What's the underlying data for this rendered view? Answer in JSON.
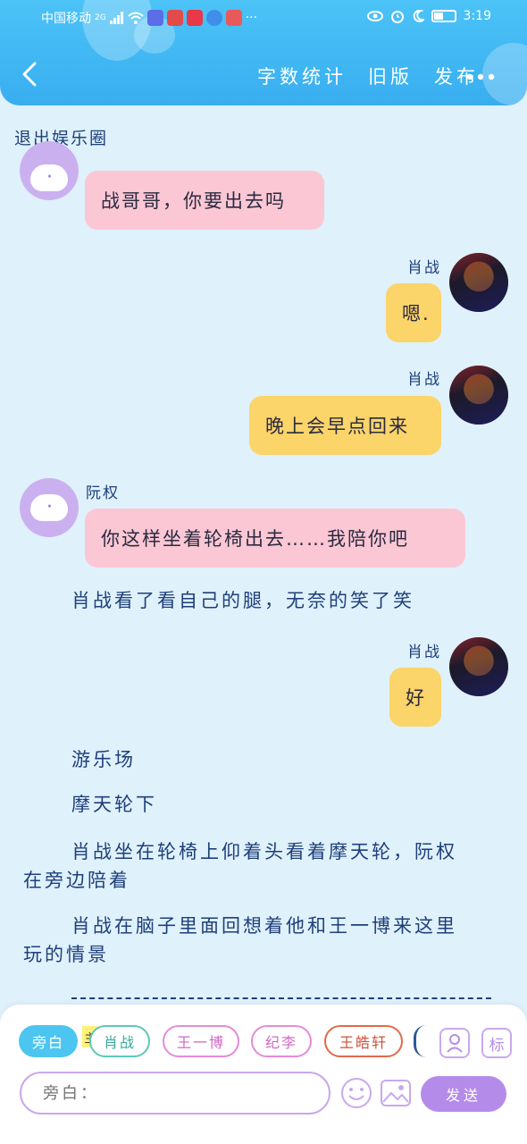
{
  "status_bar": {
    "carrier": "中国移动",
    "network": "2G",
    "more": "···",
    "time": "3:19"
  },
  "header": {
    "back_icon": "chevron-left-icon",
    "word_count": "字数统计",
    "old_version": "旧版",
    "publish": "发布",
    "more_icon": "more-horizontal-icon"
  },
  "story": {
    "title": "退出娱乐圈"
  },
  "messages": [
    {
      "speaker": "",
      "side": "left",
      "text": "战哥哥，你要出去吗",
      "color": "#fbc7d4"
    },
    {
      "speaker": "肖战",
      "side": "right",
      "text": "嗯.",
      "color": "#fbd46a"
    },
    {
      "speaker": "肖战",
      "side": "right",
      "text": "晚上会早点回来",
      "color": "#fbd46a"
    },
    {
      "speaker": "阮权",
      "side": "left",
      "text": "你这样坐着轮椅出去……我陪你吧",
      "color": "#fbc7d4"
    },
    {
      "speaker": "肖战",
      "side": "right",
      "text": "好",
      "color": "#fbd46a"
    }
  ],
  "narration": [
    "肖战看了看自己的腿，无奈的笑了笑",
    "游乐场",
    "摩天轮下",
    "肖战坐在轮椅上仰着头看着摩天轮，阮权",
    "在旁边陪着",
    "肖战在脑子里面回想着他和王一博来这里",
    "玩的情景"
  ],
  "composer": {
    "roles": [
      {
        "label": "旁白",
        "active": true,
        "color": "#4cc6f0"
      },
      {
        "label": "肖战",
        "active": false,
        "color": "#5cc8b8"
      },
      {
        "label": "王一博",
        "active": false,
        "color": "#e58bd8"
      },
      {
        "label": "纪李",
        "active": false,
        "color": "#e58bd8"
      },
      {
        "label": "王皓轩",
        "active": false,
        "color": "#e06a4a"
      }
    ],
    "main_tag": "主",
    "mark_label": "标",
    "input_placeholder": "旁白：",
    "send_label": "发送"
  }
}
